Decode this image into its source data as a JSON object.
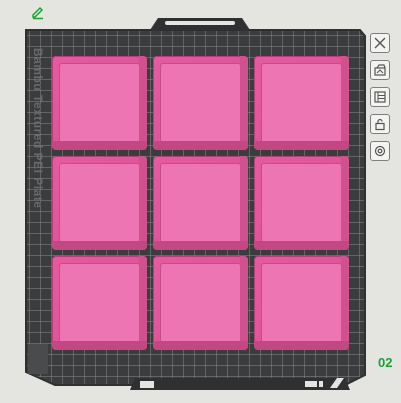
{
  "plate": {
    "label": "Bambu Textured PEI Plate",
    "number": "02"
  },
  "grid": {
    "rows": 3,
    "cols": 3,
    "bin_color": "#e65ba0"
  },
  "toolbar": {
    "buttons": [
      {
        "icon": "close-icon"
      },
      {
        "icon": "auto-orient-icon"
      },
      {
        "icon": "arrange-icon"
      },
      {
        "icon": "lock-icon"
      },
      {
        "icon": "settings-icon"
      }
    ]
  },
  "colors": {
    "plate_frame": "#3b3c3e",
    "grid_lines": "#8a8b8d",
    "background": "#e4e4e1",
    "accent_green": "#1aa335"
  }
}
